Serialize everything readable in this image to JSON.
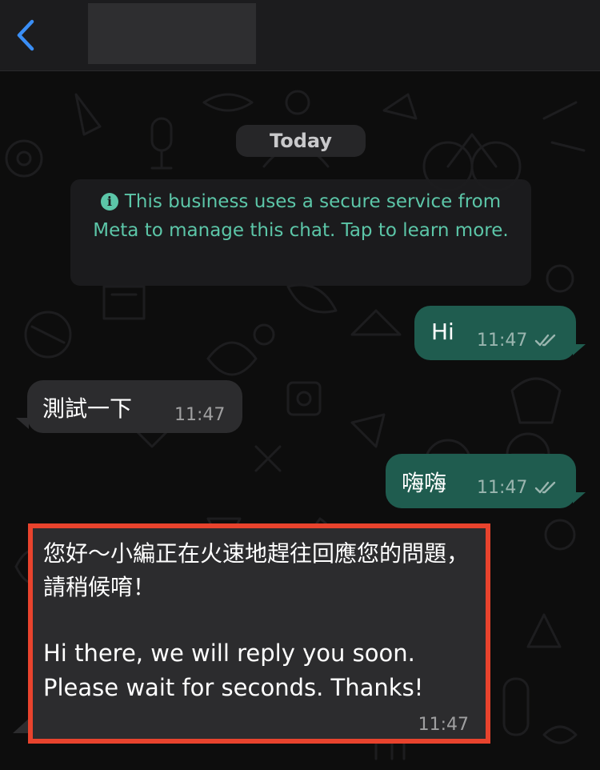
{
  "header": {
    "back_icon": "chevron-left-icon",
    "accent": "#3a8ef6"
  },
  "chat": {
    "date_label": "Today",
    "notice": {
      "icon": "info-icon",
      "icon_glyph": "i",
      "text": "This business uses a secure service from Meta to manage this chat. Tap to learn more."
    },
    "messages": [
      {
        "direction": "outgoing",
        "text": "Hi",
        "time": "11:47",
        "status": "read-double-check"
      },
      {
        "direction": "incoming",
        "text": "測試一下",
        "time": "11:47"
      },
      {
        "direction": "outgoing",
        "text": "嗨嗨",
        "time": "11:47",
        "status": "read-double-check"
      },
      {
        "direction": "incoming",
        "text_zh": "您好～小編正在火速地趕往回應您的問題，請稍候唷！",
        "text_en": "Hi there, we will reply you soon. Please wait for seconds. Thanks!",
        "time": "11:47",
        "highlighted": true
      }
    ]
  },
  "colors": {
    "outgoing_bubble": "#1f5c4f",
    "incoming_bubble": "#2c2c2e",
    "notice_text": "#5cc6a8",
    "highlight_border": "#e8432d"
  }
}
